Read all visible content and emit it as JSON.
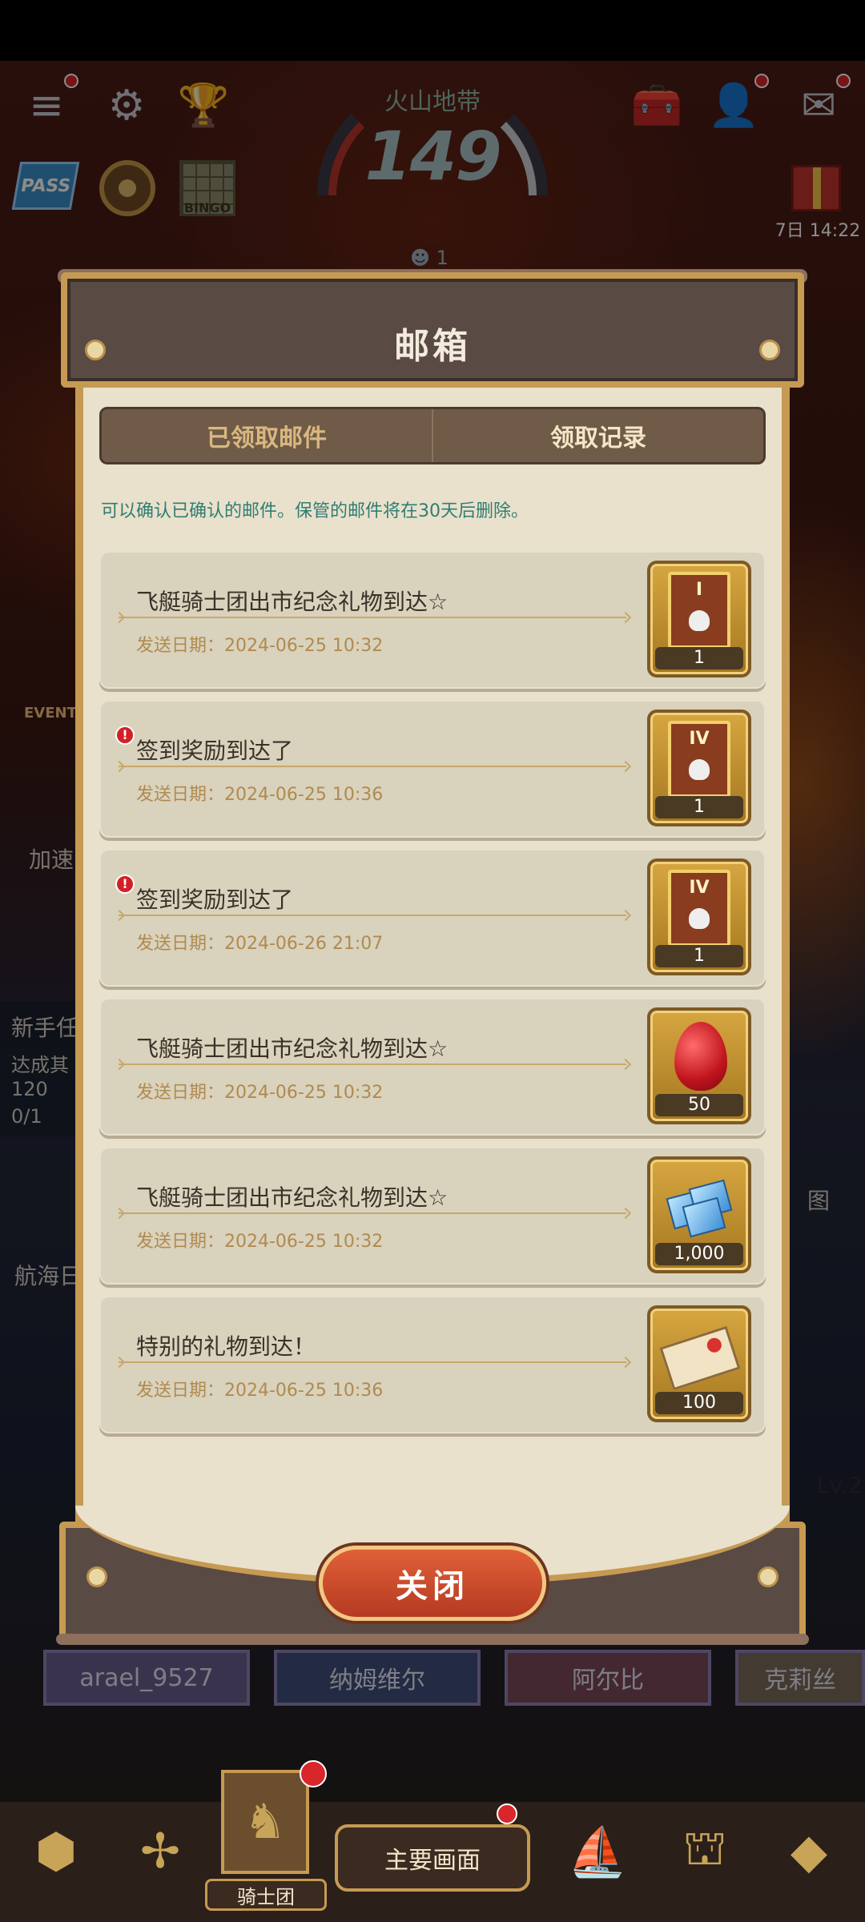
{
  "hud": {
    "zone_title": "火山地带",
    "zone_level": "149",
    "zone_sub": "1",
    "pass_label": "PASS",
    "bingo_label": "BINGO",
    "gift_timer": "7日 14:22"
  },
  "side": {
    "event_label": "EVENT",
    "boost_label": "加速",
    "newbie_label": "新手任",
    "quest_text": "达成其",
    "quest_value": "120",
    "quest_progress": "0/1",
    "voyage_label": "航海日",
    "map_label": "图",
    "level_label": "Lv.2"
  },
  "modal": {
    "title": "邮箱",
    "tabs": [
      {
        "label": "已领取邮件",
        "active": false
      },
      {
        "label": "领取记录",
        "active": true
      }
    ],
    "notice": "可以确认已确认的邮件。保管的邮件将在30天后删除。",
    "close_label": "关闭",
    "mails": [
      {
        "subject": "飞艇骑士团出市纪念礼物到达☆",
        "date": "发送日期：2024-06-25 10:32",
        "reward_count": "1",
        "reward_icon": "card-tier-1-icon",
        "card_tier": "I",
        "unread": false
      },
      {
        "subject": "签到奖励到达了",
        "date": "发送日期：2024-06-25 10:36",
        "reward_count": "1",
        "reward_icon": "card-tier-4-icon",
        "card_tier": "IV",
        "unread": true
      },
      {
        "subject": "签到奖励到达了",
        "date": "发送日期：2024-06-26 21:07",
        "reward_count": "1",
        "reward_icon": "card-tier-4-icon",
        "card_tier": "IV",
        "unread": true
      },
      {
        "subject": "飞艇骑士团出市纪念礼物到达☆",
        "date": "发送日期：2024-06-25 10:32",
        "reward_count": "50",
        "reward_icon": "ruby-icon",
        "unread": false
      },
      {
        "subject": "飞艇骑士团出市纪念礼物到达☆",
        "date": "发送日期：2024-06-25 10:32",
        "reward_count": "1,000",
        "reward_icon": "diamond-icon",
        "unread": false
      },
      {
        "subject": "特别的礼物到达！",
        "date": "发送日期：2024-06-25 10:36",
        "reward_count": "100",
        "reward_icon": "ticket-icon",
        "unread": false
      }
    ]
  },
  "bottom": {
    "characters": [
      "arael_9527",
      "纳姆维尔",
      "阿尔比",
      "克莉丝"
    ],
    "main_button": "主要画面",
    "knight_label": "骑士团"
  },
  "colors": {
    "accent_gold": "#c69a52",
    "panel_bg": "#e9e1cc",
    "notice_teal": "#2f7d73",
    "close_red": "#c0462a"
  }
}
